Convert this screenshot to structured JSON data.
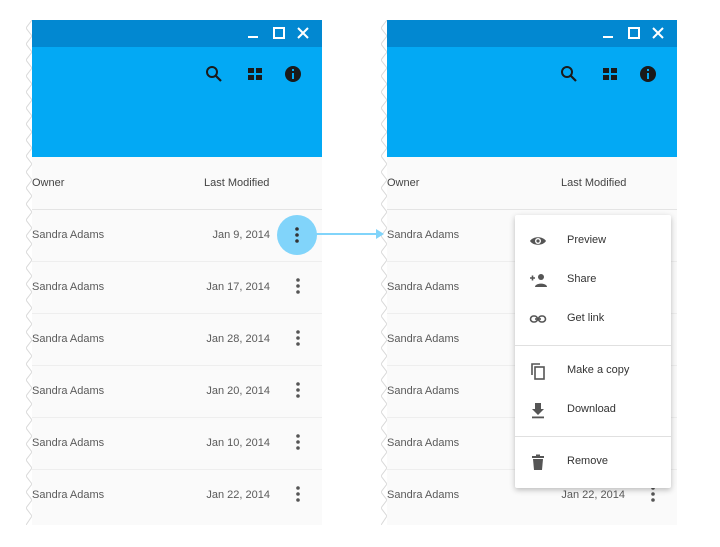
{
  "colors": {
    "title_bar": "#0288d1",
    "app_bar": "#03a9f4",
    "ripple": "#81d4fa",
    "arrow": "#81d4fa"
  },
  "window_controls": {
    "minimize": "minimize-icon",
    "maximize": "maximize-icon",
    "close": "close-icon"
  },
  "toolbar_icons": [
    "search-icon",
    "grid-view-icon",
    "info-icon"
  ],
  "table": {
    "headers": {
      "owner": "Owner",
      "last_modified": "Last Modified"
    },
    "rows": [
      {
        "owner": "Sandra Adams",
        "date": "Jan 9, 2014"
      },
      {
        "owner": "Sandra Adams",
        "date": "Jan 17, 2014"
      },
      {
        "owner": "Sandra Adams",
        "date": "Jan 28, 2014"
      },
      {
        "owner": "Sandra Adams",
        "date": "Jan 20, 2014"
      },
      {
        "owner": "Sandra Adams",
        "date": "Jan 10, 2014"
      },
      {
        "owner": "Sandra Adams",
        "date": "Jan 22, 2014"
      }
    ]
  },
  "menu": {
    "items": [
      {
        "label": "Preview",
        "icon": "eye-icon"
      },
      {
        "label": "Share",
        "icon": "person-add-icon"
      },
      {
        "label": "Get link",
        "icon": "link-icon"
      },
      {
        "label": "Make a copy",
        "icon": "copy-icon"
      },
      {
        "label": "Download",
        "icon": "download-icon"
      },
      {
        "label": "Remove",
        "icon": "trash-icon"
      }
    ]
  }
}
